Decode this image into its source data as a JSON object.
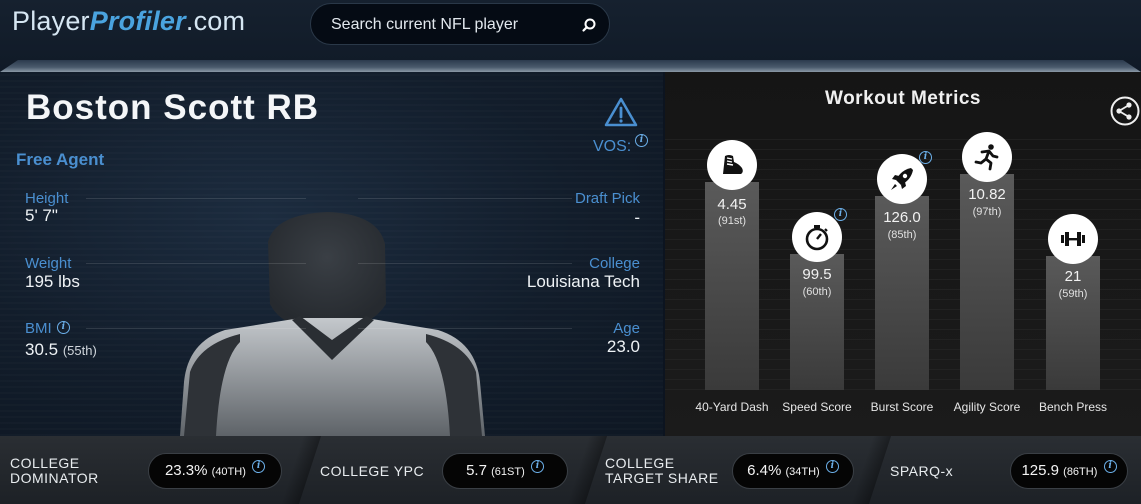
{
  "header": {
    "logo": {
      "part1": "Player",
      "part2": "Profiler",
      "part3": ".com"
    },
    "search": {
      "placeholder": "Search current NFL player"
    }
  },
  "profile": {
    "player_name": "Boston Scott RB",
    "team": "Free Agent",
    "vos_label": "VOS:",
    "stats_left": [
      {
        "label": "Height",
        "value": "5' 7\""
      },
      {
        "label": "Weight",
        "value": "195 lbs"
      },
      {
        "label": "BMI",
        "value": "30.5",
        "rank": "(55th)"
      }
    ],
    "stats_right": [
      {
        "label": "Draft Pick",
        "value": "-"
      },
      {
        "label": "College",
        "value": "Louisiana Tech"
      },
      {
        "label": "Age",
        "value": "23.0"
      }
    ]
  },
  "workout": {
    "title": "Workout Metrics",
    "metrics": [
      {
        "label": "40-Yard Dash",
        "value": "4.45",
        "percentile": "(91st)",
        "percentile_value": 91,
        "icon": "shoe-icon"
      },
      {
        "label": "Speed Score",
        "value": "99.5",
        "percentile": "(60th)",
        "percentile_value": 60,
        "icon": "stopwatch-icon"
      },
      {
        "label": "Burst Score",
        "value": "126.0",
        "percentile": "(85th)",
        "percentile_value": 85,
        "icon": "rocket-icon"
      },
      {
        "label": "Agility Score",
        "value": "10.82",
        "percentile": "(97th)",
        "percentile_value": 97,
        "icon": "runner-icon"
      },
      {
        "label": "Bench Press",
        "value": "21",
        "percentile": "(59th)",
        "percentile_value": 59,
        "icon": "barbell-icon"
      }
    ]
  },
  "bottom": [
    {
      "label_line1": "COLLEGE",
      "label_line2": "DOMINATOR",
      "value": "23.3%",
      "rank": "(40TH)"
    },
    {
      "label_line1": "COLLEGE YPC",
      "label_line2": "",
      "value": "5.7",
      "rank": "(61ST)"
    },
    {
      "label_line1": "COLLEGE",
      "label_line2": "TARGET SHARE",
      "value": "6.4%",
      "rank": "(34TH)"
    },
    {
      "label_line1": "SPARQ-x",
      "label_line2": "",
      "value": "125.9",
      "rank": "(86TH)"
    }
  ],
  "colors": {
    "accent": "#4a8fd0",
    "logo_blue": "#4aa3df"
  }
}
